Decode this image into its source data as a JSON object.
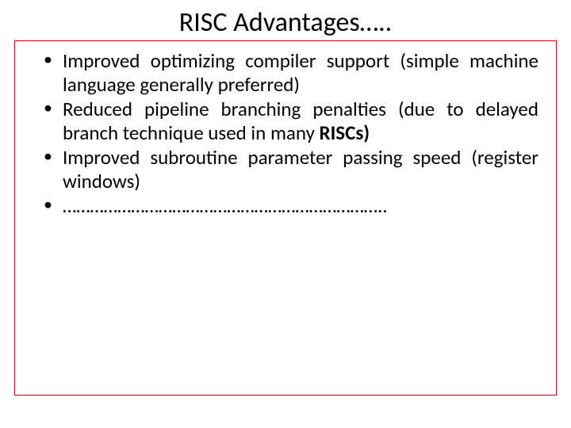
{
  "slide": {
    "title": "RISC Advantages…..",
    "bullets": [
      {
        "pre": "Improved optimizing compiler support (simple machine language generally preferred)",
        "bold": "",
        "post": ""
      },
      {
        "pre": "Reduced pipeline branching penalties (due to delayed branch technique used in many ",
        "bold": "RISCs)",
        "post": ""
      },
      {
        "pre": "Improved subroutine parameter passing speed (register windows)",
        "bold": "",
        "post": ""
      },
      {
        "pre": "……………………………………………………………..",
        "bold": "",
        "post": ""
      }
    ]
  }
}
